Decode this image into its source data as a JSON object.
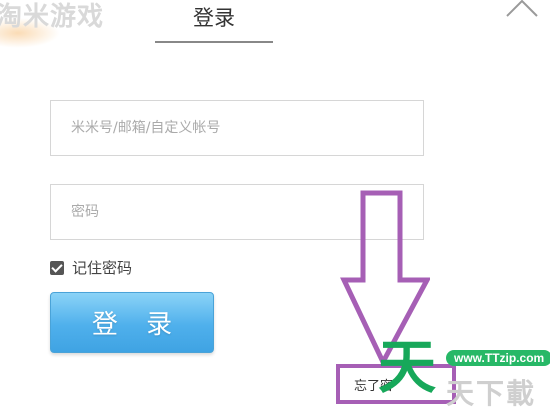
{
  "header": {
    "logo": "淘米游戏",
    "active_tab": "登录",
    "close_icon": "chevron-up-icon"
  },
  "form": {
    "account_placeholder": "米米号/邮箱/自定义帐号",
    "password_placeholder": "密码",
    "remember_label": "记住密码",
    "remember_checked": true,
    "login_button": "登 录",
    "forgot_label": "忘了密"
  },
  "annotation": {
    "arrow_color": "#a65fb5"
  },
  "watermark": {
    "brand_char": "天",
    "url": "www.TTzip.com",
    "sub": "天下載",
    "color": "#17a85a"
  }
}
